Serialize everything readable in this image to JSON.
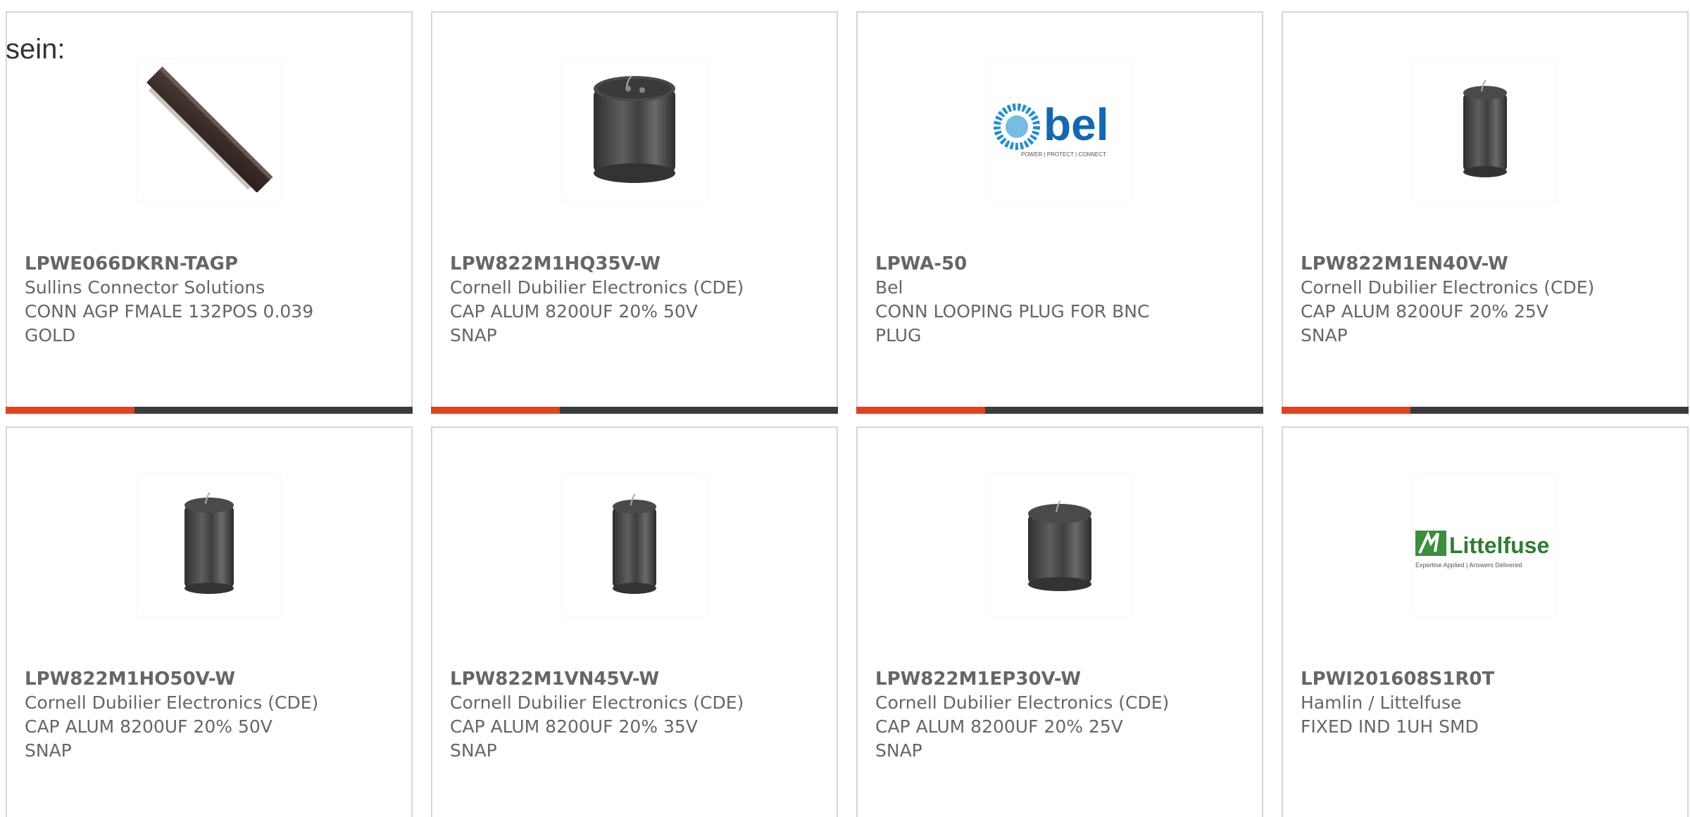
{
  "overlay": {
    "text": "sein:"
  },
  "colors": {
    "accent": "#e4411d",
    "bar": "#3c3c3c",
    "text": "#666666",
    "border": "#d6d6d6"
  },
  "cards": [
    {
      "image": "connector-image",
      "part_number": "LPWE066DKRN-TAGP",
      "manufacturer": "Sullins Connector Solutions",
      "desc_line1": "CONN AGP FMALE 132POS 0.039",
      "desc_line2": "GOLD",
      "progress": 0.316
    },
    {
      "image": "capacitor-image",
      "part_number": "LPW822M1HQ35V-W",
      "manufacturer": "Cornell Dubilier Electronics (CDE)",
      "desc_line1": "CAP ALUM 8200UF 20% 50V",
      "desc_line2": "SNAP",
      "progress": 0.316
    },
    {
      "image": "bel-logo",
      "logo_text": "bel",
      "logo_tagline": "POWER | PROTECT | CONNECT",
      "part_number": "LPWA-50",
      "manufacturer": "Bel",
      "desc_line1": "CONN LOOPING PLUG FOR BNC",
      "desc_line2": "PLUG",
      "progress": 0.316
    },
    {
      "image": "capacitor-image",
      "part_number": "LPW822M1EN40V-W",
      "manufacturer": "Cornell Dubilier Electronics (CDE)",
      "desc_line1": "CAP ALUM 8200UF 20% 25V",
      "desc_line2": "SNAP",
      "progress": 0.316
    },
    {
      "image": "capacitor-image",
      "part_number": "LPW822M1HO50V-W",
      "manufacturer": "Cornell Dubilier Electronics (CDE)",
      "desc_line1": "CAP ALUM 8200UF 20% 50V",
      "desc_line2": "SNAP"
    },
    {
      "image": "capacitor-image",
      "part_number": "LPW822M1VN45V-W",
      "manufacturer": "Cornell Dubilier Electronics (CDE)",
      "desc_line1": "CAP ALUM 8200UF 20% 35V",
      "desc_line2": "SNAP"
    },
    {
      "image": "capacitor-image",
      "part_number": "LPW822M1EP30V-W",
      "manufacturer": "Cornell Dubilier Electronics (CDE)",
      "desc_line1": "CAP ALUM 8200UF 20% 25V",
      "desc_line2": "SNAP"
    },
    {
      "image": "littelfuse-logo",
      "logo_text": "Littelfuse",
      "logo_tagline": "Expertise Applied | Answers Delivered",
      "part_number": "LPWI201608S1R0T",
      "manufacturer": "Hamlin / Littelfuse",
      "desc_line1": "FIXED IND 1UH SMD",
      "desc_line2": ""
    }
  ]
}
